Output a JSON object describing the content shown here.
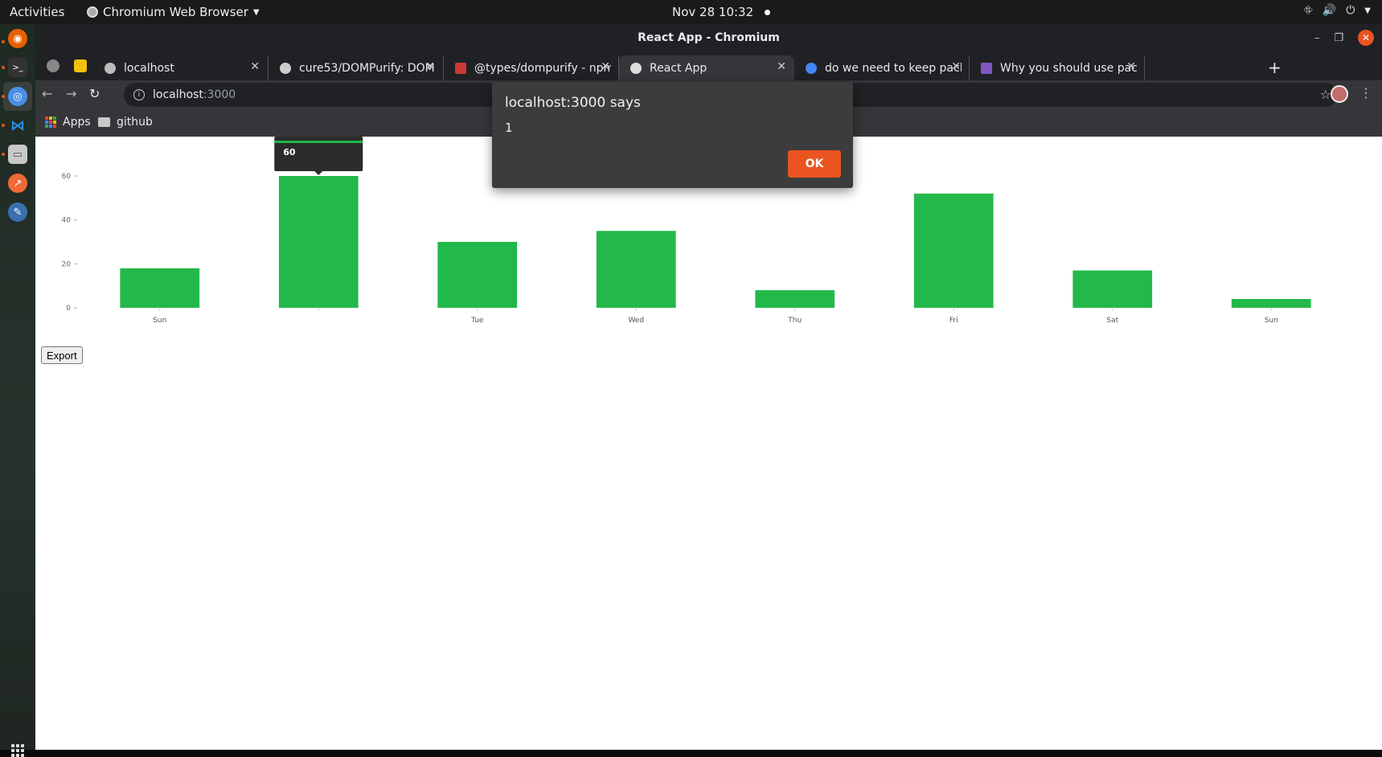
{
  "topbar": {
    "activities": "Activities",
    "app_name": "Chromium Web Browser",
    "clock": "Nov 28  10:32"
  },
  "window": {
    "title": "React App - Chromium"
  },
  "tabs": [
    {
      "label": "localhost",
      "favicon_color": "#bbbbbb"
    },
    {
      "label": "cure53/DOMPurify: DOM",
      "favicon_color": "#cccccc"
    },
    {
      "label": "@types/dompurify - npm",
      "favicon_color": "#cb3837"
    },
    {
      "label": "React App",
      "favicon_color": "#dddddd"
    },
    {
      "label": "do we need to keep packa",
      "favicon_color": "#4285f4"
    },
    {
      "label": "Why you should use packa",
      "favicon_color": "#7e57c2"
    }
  ],
  "address_bar": {
    "host": "localhost",
    "port": ":3000"
  },
  "bookmarks": [
    {
      "label": "Apps"
    },
    {
      "label": "github"
    }
  ],
  "chart_data": {
    "type": "bar",
    "categories": [
      "Sun",
      "",
      "Tue",
      "Wed",
      "Thu",
      "Fri",
      "Sat",
      "Sun"
    ],
    "values": [
      18,
      60,
      30,
      35,
      8,
      52,
      17,
      4
    ],
    "yticks": [
      0,
      20,
      40,
      60
    ],
    "ylim": [
      0,
      60
    ],
    "color": "#22b84a",
    "tooltip": {
      "index": 1,
      "value": "60"
    }
  },
  "page": {
    "export_label": "Export"
  },
  "dialog": {
    "title": "localhost:3000 says",
    "message": "1",
    "ok_label": "OK",
    "ok_color": "#e95420"
  }
}
